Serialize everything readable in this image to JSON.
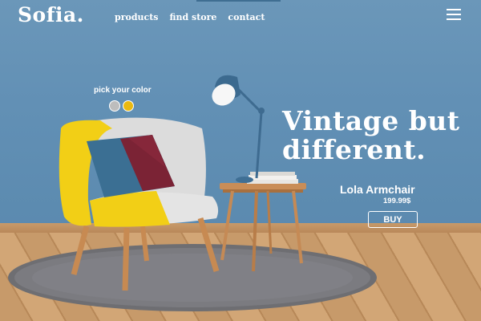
{
  "brand": {
    "logo": "Sofia."
  },
  "nav": {
    "items": [
      "products",
      "find store",
      "contact"
    ]
  },
  "color_picker": {
    "label": "pick your color",
    "options": [
      {
        "name": "gray",
        "color": "#bdbdbd"
      },
      {
        "name": "yellow",
        "color": "#e9b911",
        "selected": true
      }
    ]
  },
  "hero": {
    "headline_line1": "Vintage but",
    "headline_line2": "different.",
    "product_name": "Lola Armchair",
    "price": "199.99$",
    "buy_label": "BUY"
  },
  "colors": {
    "wall": "#6290b5",
    "accent": "#e9b911",
    "text": "#ffffff"
  }
}
